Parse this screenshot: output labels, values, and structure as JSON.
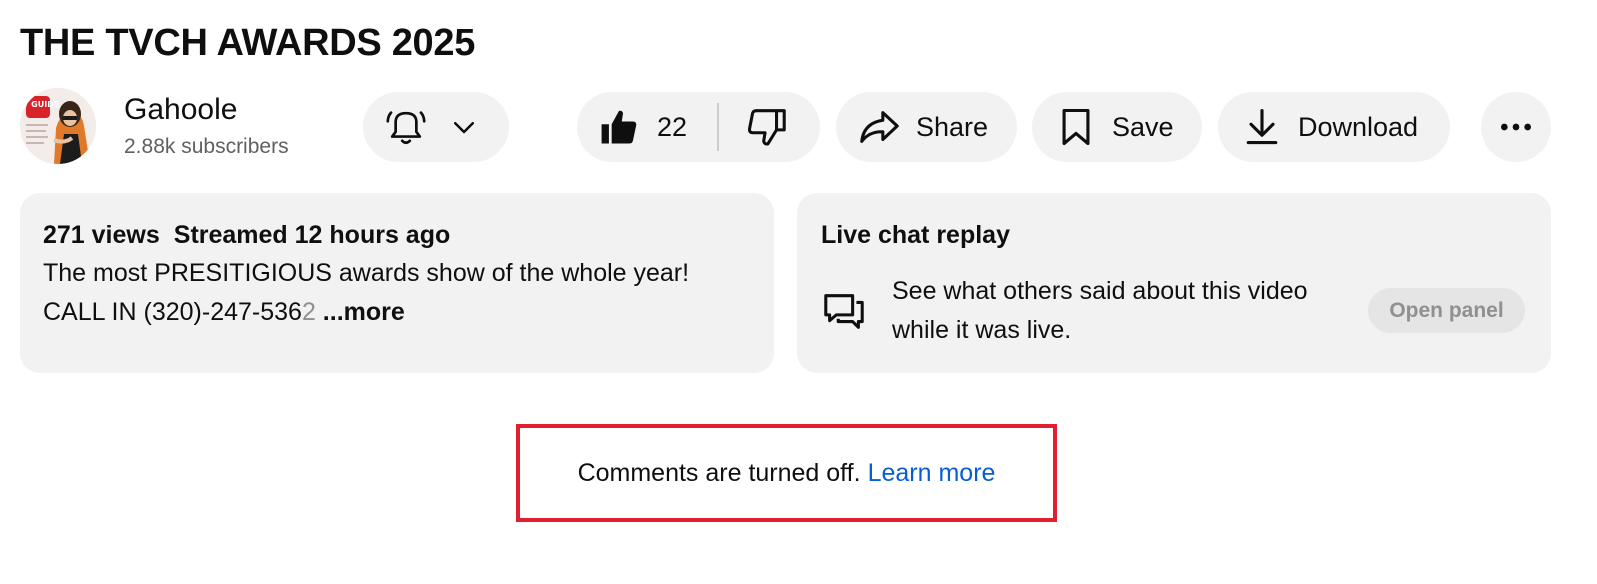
{
  "video": {
    "title": "THE TVCH AWARDS 2025"
  },
  "channel": {
    "name": "Gahoole",
    "subscribers": "2.88k subscribers",
    "avatar_icon": "tv-guide-cover-avatar",
    "avatar_text": "TV GUIDE"
  },
  "actions": {
    "subscribe_icon": "bell-icon",
    "like_count": "22",
    "share_label": "Share",
    "save_label": "Save",
    "download_label": "Download"
  },
  "description": {
    "views": "271 views",
    "streamed": "Streamed 12 hours ago",
    "line1": "The most PRESITIGIOUS awards show of the whole year!",
    "line2_main": "CALL IN (320)-247-536",
    "line2_faded": "2",
    "more_label": "...more"
  },
  "live_chat": {
    "title": "Live chat replay",
    "text": "See what others said about this video while it was live.",
    "open_panel_label": "Open panel"
  },
  "comments": {
    "status_text": "Comments are turned off.",
    "learn_more_label": "Learn more"
  },
  "colors": {
    "pill_bg": "#f2f2f2",
    "link": "#065fd4",
    "highlight_border": "#e0202f",
    "secondary_text": "#606060"
  }
}
